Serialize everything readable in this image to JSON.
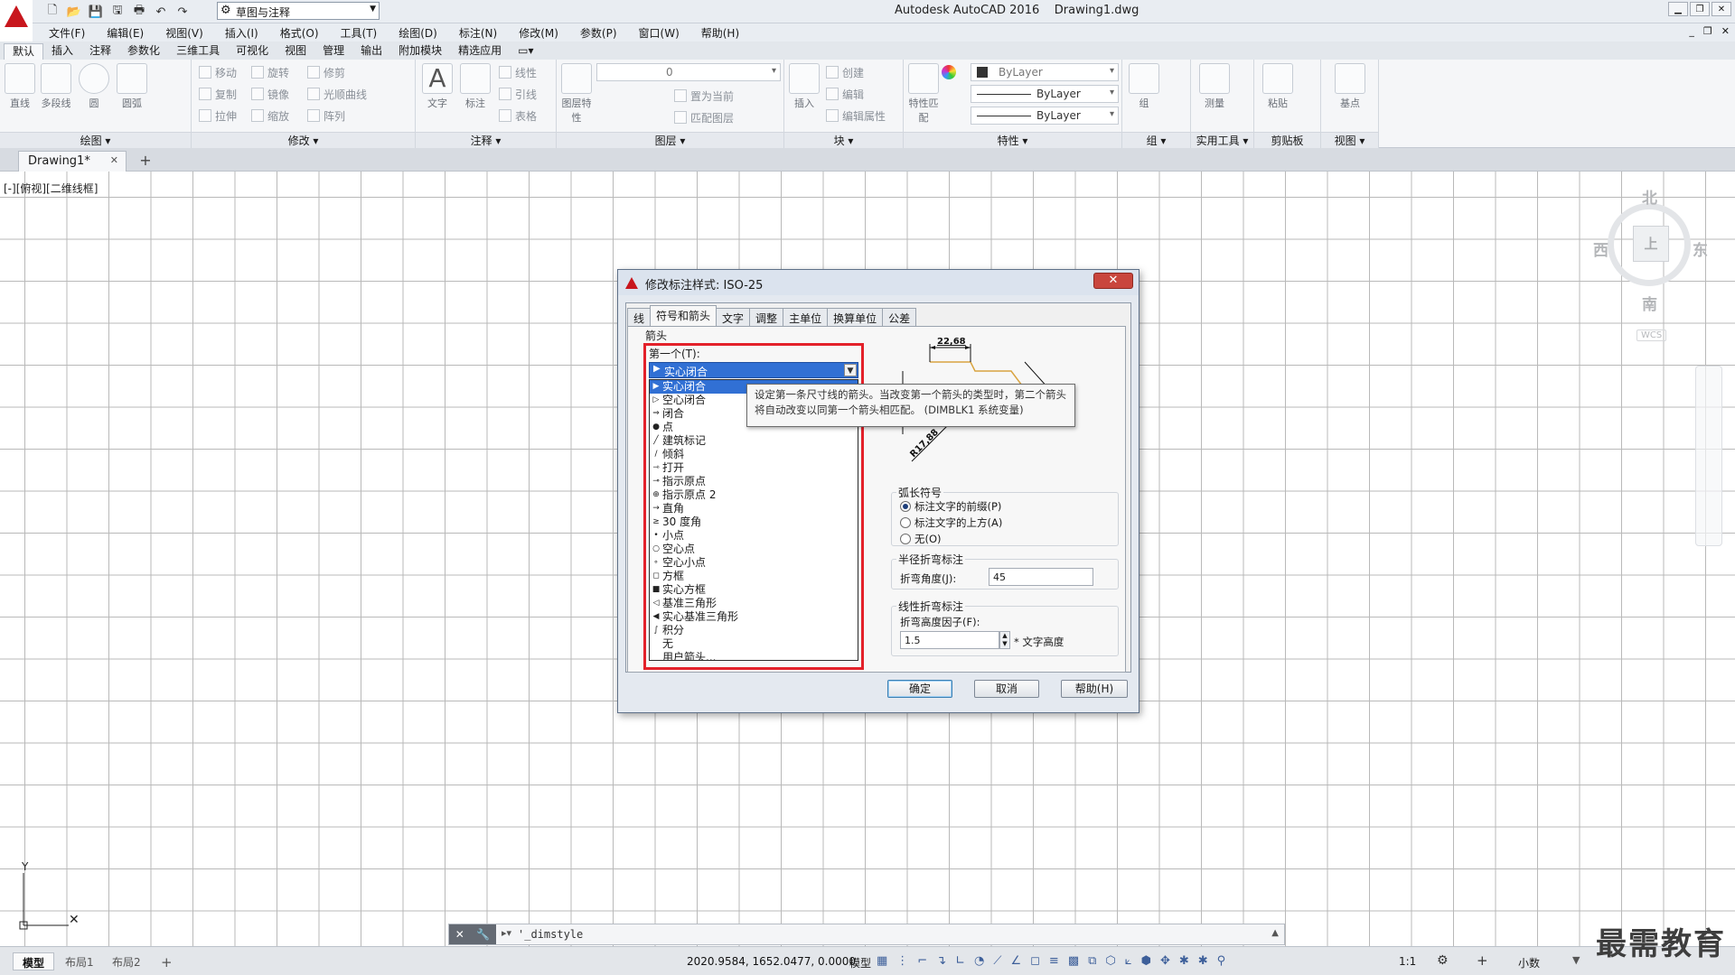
{
  "app": {
    "title": "Autodesk AutoCAD 2016    Drawing1.dwg",
    "workspace": "草图与注释"
  },
  "menu": [
    "文件(F)",
    "编辑(E)",
    "视图(V)",
    "插入(I)",
    "格式(O)",
    "工具(T)",
    "绘图(D)",
    "标注(N)",
    "修改(M)",
    "参数(P)",
    "窗口(W)",
    "帮助(H)"
  ],
  "ribbon_tabs": [
    "默认",
    "插入",
    "注释",
    "参数化",
    "三维工具",
    "可视化",
    "视图",
    "管理",
    "输出",
    "附加模块",
    "精选应用"
  ],
  "ribbon": {
    "draw": {
      "title": "绘图",
      "line": "直线",
      "polyline": "多段线",
      "circle": "圆",
      "arc": "圆弧"
    },
    "modify": {
      "title": "修改",
      "move": "移动",
      "rotate": "旋转",
      "trim": "修剪",
      "copy": "复制",
      "mirror": "镜像",
      "fillet": "光顺曲线",
      "stretch": "拉伸",
      "scale": "缩放",
      "array": "阵列"
    },
    "annotation": {
      "title": "注释",
      "text": "文字",
      "dimension": "标注",
      "linear": "线性",
      "leader": "引线",
      "table": "表格"
    },
    "layers": {
      "title": "图层",
      "properties": "图层特性",
      "layer_value": "0",
      "set_current": "置为当前",
      "match": "匹配图层"
    },
    "block": {
      "title": "块",
      "insert": "插入",
      "create": "创建",
      "edit": "编辑",
      "edit_attr": "编辑属性"
    },
    "properties": {
      "title": "特性",
      "match": "特性匹配",
      "color": "ByLayer",
      "linetype": "ByLayer",
      "lineweight": "ByLayer"
    },
    "groups": {
      "title": "组",
      "group": "组"
    },
    "utilities": {
      "title": "实用工具",
      "measure": "测量"
    },
    "clipboard": {
      "title": "剪贴板",
      "paste": "粘贴"
    },
    "view": {
      "title": "视图",
      "base": "基点"
    }
  },
  "doc_tab": "Drawing1*",
  "view_label": "[-][俯视][二维线框]",
  "viewcube": {
    "north": "北",
    "south": "南",
    "east": "东",
    "west": "西",
    "top": "上",
    "wcs": "WCS"
  },
  "dialog": {
    "title": "修改标注样式: ISO-25",
    "tabs": [
      "线",
      "符号和箭头",
      "文字",
      "调整",
      "主单位",
      "换算单位",
      "公差"
    ],
    "arrows_section": "箭头",
    "first_label": "第一个(T):",
    "first_value": "实心闭合",
    "arrow_options": [
      "实心闭合",
      "空心闭合",
      "闭合",
      "点",
      "建筑标记",
      "倾斜",
      "打开",
      "指示原点",
      "指示原点 2",
      "直角",
      "30 度角",
      "小点",
      "空心点",
      "空心小点",
      "方框",
      "实心方框",
      "基准三角形",
      "实心基准三角形",
      "积分",
      "无",
      "用户箭头..."
    ],
    "tooltip": "设定第一条尺寸线的箭头。当改变第一个箭头的类型时，第二个箭头将自动改变以同第一个箭头相匹配。 (DIMBLK1 系统变量)",
    "preview_dim": "22,68",
    "preview_radius": "R17,88",
    "arc_section": "弧长符号",
    "arc_options": [
      "标注文字的前缀(P)",
      "标注文字的上方(A)",
      "无(O)"
    ],
    "radius_jog_section": "半径折弯标注",
    "jog_angle_label": "折弯角度(J):",
    "jog_angle_value": "45",
    "linear_jog_section": "线性折弯标注",
    "jog_height_label": "折弯高度因子(F):",
    "jog_height_value": "1.5",
    "text_height_label": "* 文字高度",
    "ok": "确定",
    "cancel": "取消",
    "help": "帮助(H)"
  },
  "command_line": "'_dimstyle",
  "status": {
    "layouts": [
      "模型",
      "布局1",
      "布局2"
    ],
    "coords": "2020.9584, 1652.0477, 0.0000",
    "model": "模型",
    "scale": "1:1",
    "units": "小数"
  },
  "watermark": "最需教育"
}
